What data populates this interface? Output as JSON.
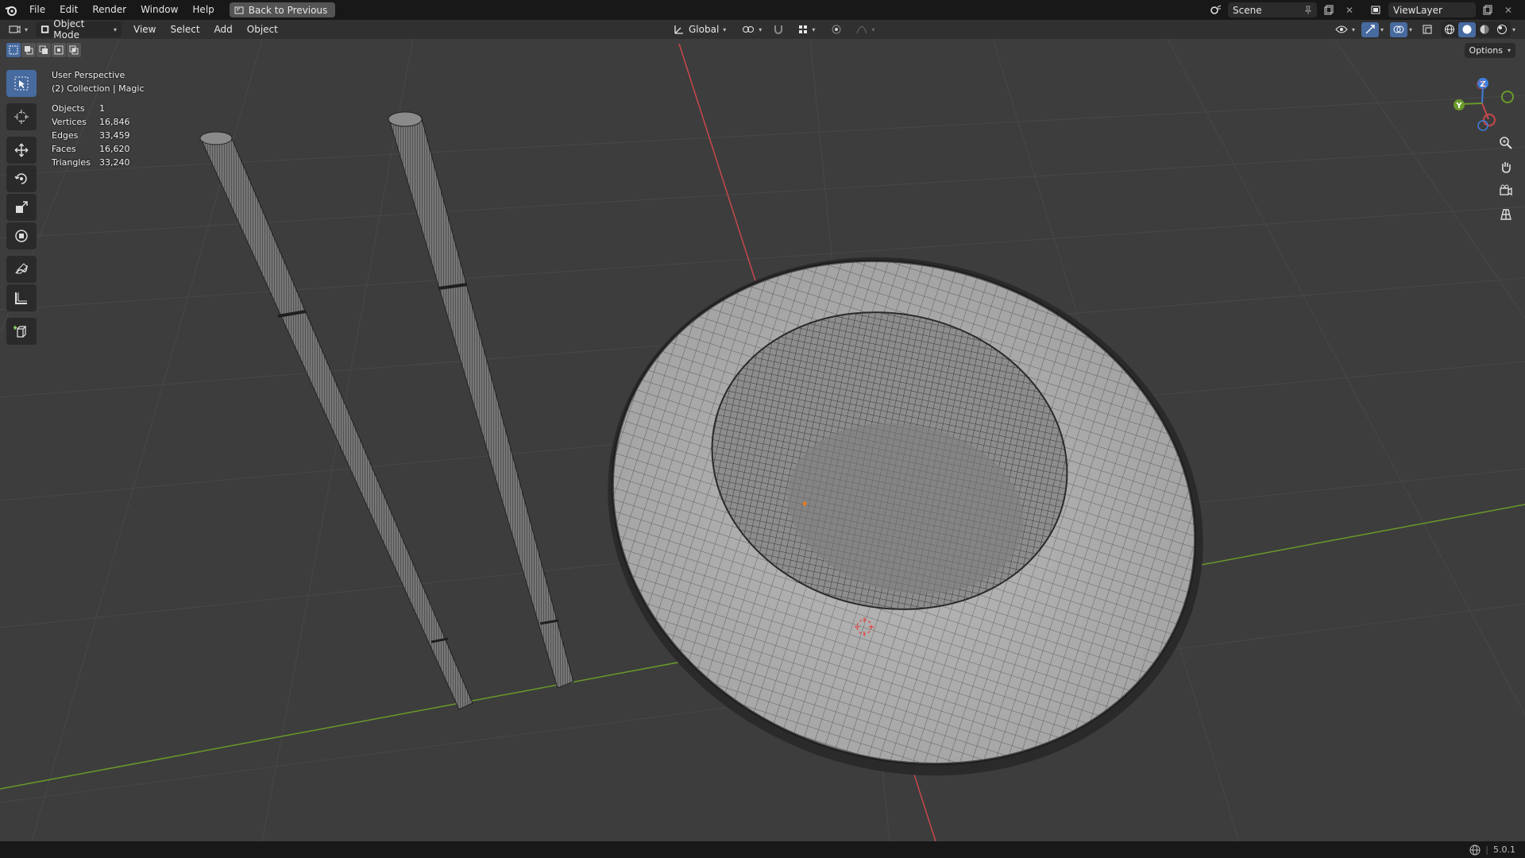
{
  "topbar": {
    "menus": [
      "File",
      "Edit",
      "Render",
      "Window",
      "Help"
    ],
    "back_label": "Back to Previous",
    "scene_label": "Scene",
    "viewlayer_label": "ViewLayer"
  },
  "header": {
    "mode_label": "Object Mode",
    "menus": [
      "View",
      "Select",
      "Add",
      "Object"
    ],
    "transform_orientation": "Global",
    "options_label": "Options"
  },
  "overlay": {
    "view_name": "User Perspective",
    "collection": "(2) Collection | Magic",
    "stats": [
      {
        "label": "Objects",
        "value": "1"
      },
      {
        "label": "Vertices",
        "value": "16,846"
      },
      {
        "label": "Edges",
        "value": "33,459"
      },
      {
        "label": "Faces",
        "value": "16,620"
      },
      {
        "label": "Triangles",
        "value": "33,240"
      }
    ]
  },
  "gizmo": {
    "z": "Z",
    "y": "Y"
  },
  "status": {
    "version": "5.0.1"
  },
  "colors": {
    "accent": "#476a9f",
    "x_axis": "#c8484c",
    "y_axis": "#6a9a2a",
    "z_axis": "#3f7ee0",
    "background": "#3d3d3d"
  }
}
